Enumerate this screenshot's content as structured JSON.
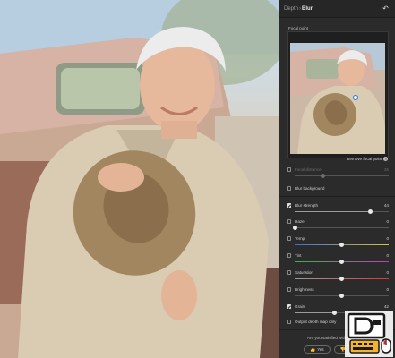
{
  "header": {
    "crumb_parent": "Depth",
    "crumb_sep": "›",
    "crumb_current": "Blur",
    "undo_icon": "undo-icon"
  },
  "focal_point": {
    "label": "Focal point",
    "remove_label": "Remove focal point"
  },
  "controls": {
    "focal_distance": {
      "label": "Focal distance",
      "value": "25",
      "enabled": false,
      "level": 0.3
    },
    "blur_background": {
      "label": "Blur background",
      "checked": false
    },
    "blur_strength": {
      "label": "Blur strength",
      "value": "44",
      "checked": true,
      "level": 0.8
    },
    "haze": {
      "label": "Haze",
      "value": "0",
      "checked": false,
      "level": 0.0
    },
    "temp": {
      "label": "Temp",
      "value": "0",
      "checked": false,
      "level": 0.5
    },
    "tint": {
      "label": "Tint",
      "value": "0",
      "checked": false,
      "level": 0.5
    },
    "saturation": {
      "label": "Saturation",
      "value": "0",
      "checked": false,
      "level": 0.5
    },
    "brightness": {
      "label": "Brightness",
      "value": "0",
      "checked": false,
      "level": 0.5
    },
    "grain": {
      "label": "Grain",
      "value": "42",
      "checked": true,
      "level": 0.42
    },
    "output_depth": {
      "label": "Output depth map only",
      "checked": false
    }
  },
  "footer": {
    "question": "Are you satisfied with the result?",
    "yes_label": "Yes",
    "no_label": "No"
  },
  "colors": {
    "panel_bg": "#2b2b2b",
    "accent_blue": "#1e6fd6",
    "temp_gradient": [
      "#3b6fd8",
      "#d9c23b"
    ],
    "tint_gradient": [
      "#3bb34a",
      "#c23bc2"
    ],
    "saturation_gradient": [
      "#9a9a9a",
      "#d8383a"
    ]
  }
}
